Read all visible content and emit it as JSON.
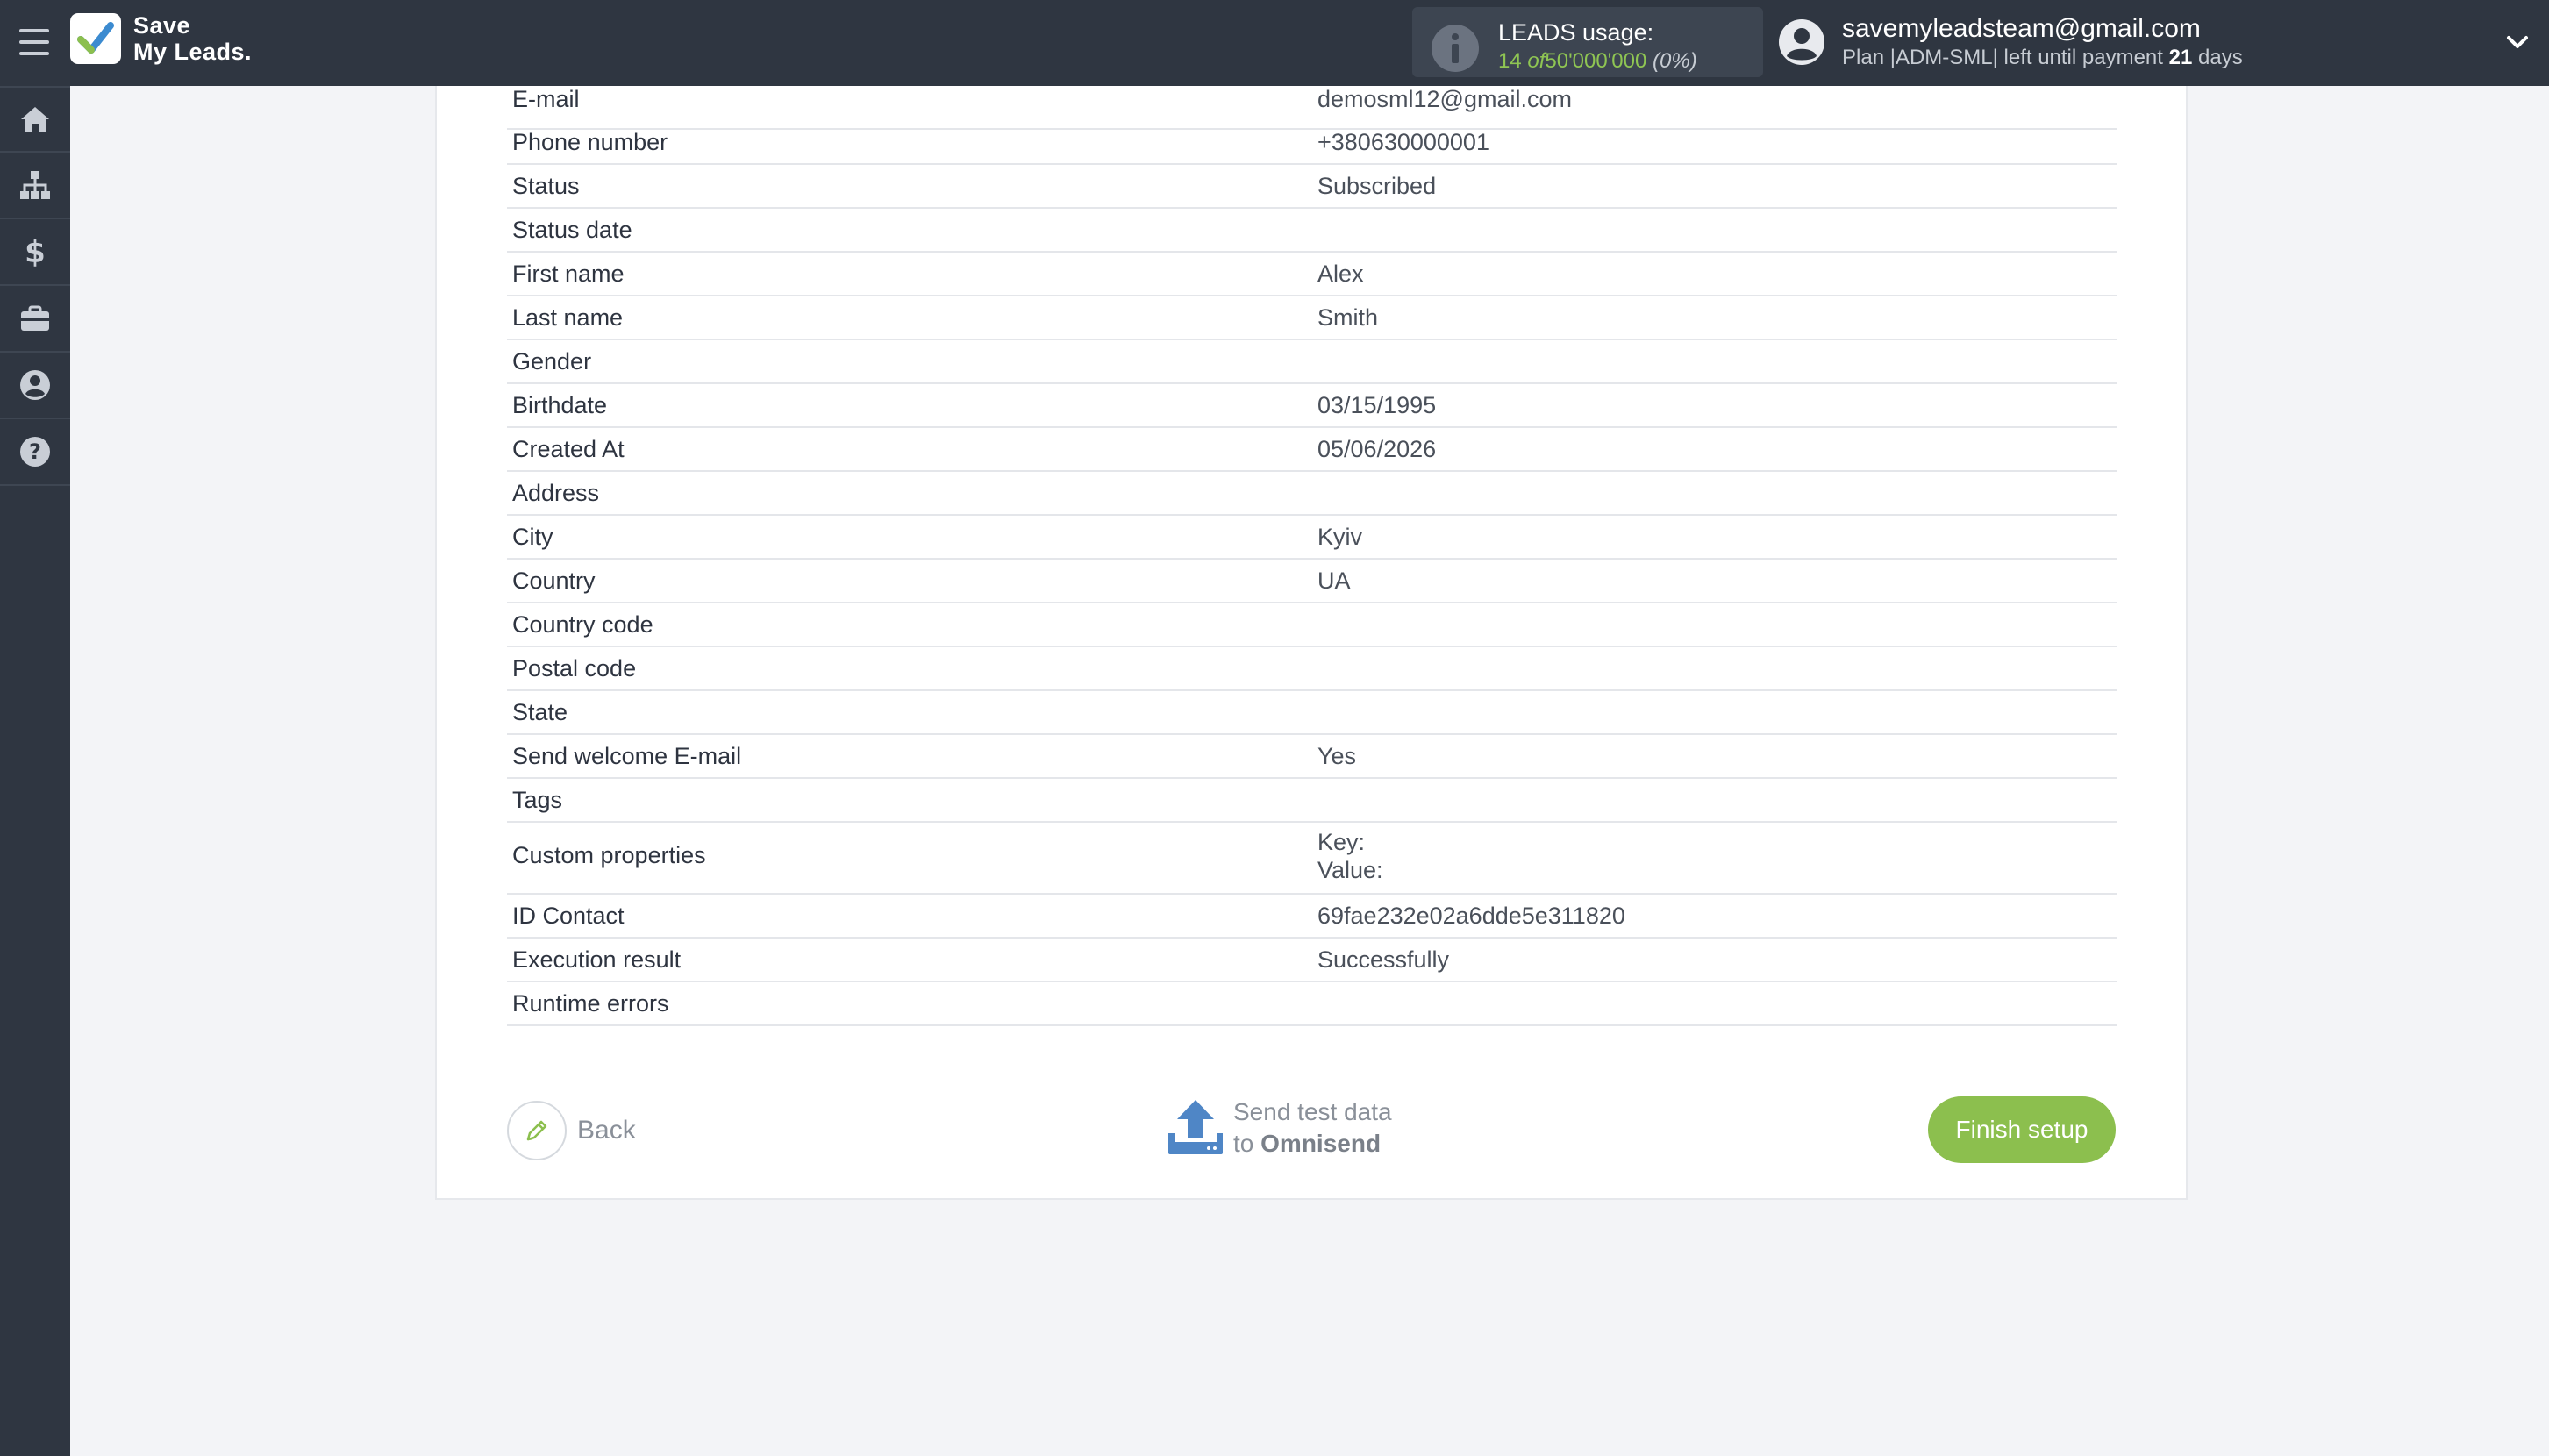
{
  "header": {
    "logo_line1": "Save",
    "logo_line2": "My Leads.",
    "leads_title": "LEADS usage:",
    "leads_used": "14",
    "leads_of": "of",
    "leads_limit": "50'000'000",
    "leads_pct": "(0%)",
    "user_email": "savemyleadsteam@gmail.com",
    "plan_prefix": "Plan |ADM-SML| left until payment",
    "plan_days": "21",
    "plan_suffix": "days"
  },
  "sidebar": {
    "items": [
      {
        "icon": "home-icon"
      },
      {
        "icon": "sitemap-icon"
      },
      {
        "icon": "dollar-icon"
      },
      {
        "icon": "briefcase-icon"
      },
      {
        "icon": "user-circle-icon"
      },
      {
        "icon": "question-icon"
      }
    ]
  },
  "fields": [
    {
      "label": "E-mail",
      "value": "demosml12@gmail.com"
    },
    {
      "label": "Phone number",
      "value": "+380630000001"
    },
    {
      "label": "Status",
      "value": "Subscribed"
    },
    {
      "label": "Status date",
      "value": ""
    },
    {
      "label": "First name",
      "value": "Alex"
    },
    {
      "label": "Last name",
      "value": "Smith"
    },
    {
      "label": "Gender",
      "value": ""
    },
    {
      "label": "Birthdate",
      "value": "03/15/1995"
    },
    {
      "label": "Created At",
      "value": "05/06/2026"
    },
    {
      "label": "Address",
      "value": ""
    },
    {
      "label": "City",
      "value": "Kyiv"
    },
    {
      "label": "Country",
      "value": "UA"
    },
    {
      "label": "Country code",
      "value": ""
    },
    {
      "label": "Postal code",
      "value": ""
    },
    {
      "label": "State",
      "value": ""
    },
    {
      "label": "Send welcome E-mail",
      "value": "Yes"
    },
    {
      "label": "Tags",
      "value": ""
    },
    {
      "label": "Custom properties",
      "value": "Key:",
      "value2": "Value:"
    },
    {
      "label": "ID Contact",
      "value": "69fae232e02a6dde5e311820"
    },
    {
      "label": "Execution result",
      "value": "Successfully"
    },
    {
      "label": "Runtime errors",
      "value": ""
    }
  ],
  "actions": {
    "back_label": "Back",
    "send_line1": "Send test data",
    "send_line2_prefix": "to",
    "send_line2_target": "Omnisend",
    "finish_label": "Finish setup"
  },
  "colors": {
    "topbar": "#2f3641",
    "accent_green": "#8cbf4e",
    "usage_green": "#8fc553",
    "send_icon_blue": "#4f86c6"
  }
}
